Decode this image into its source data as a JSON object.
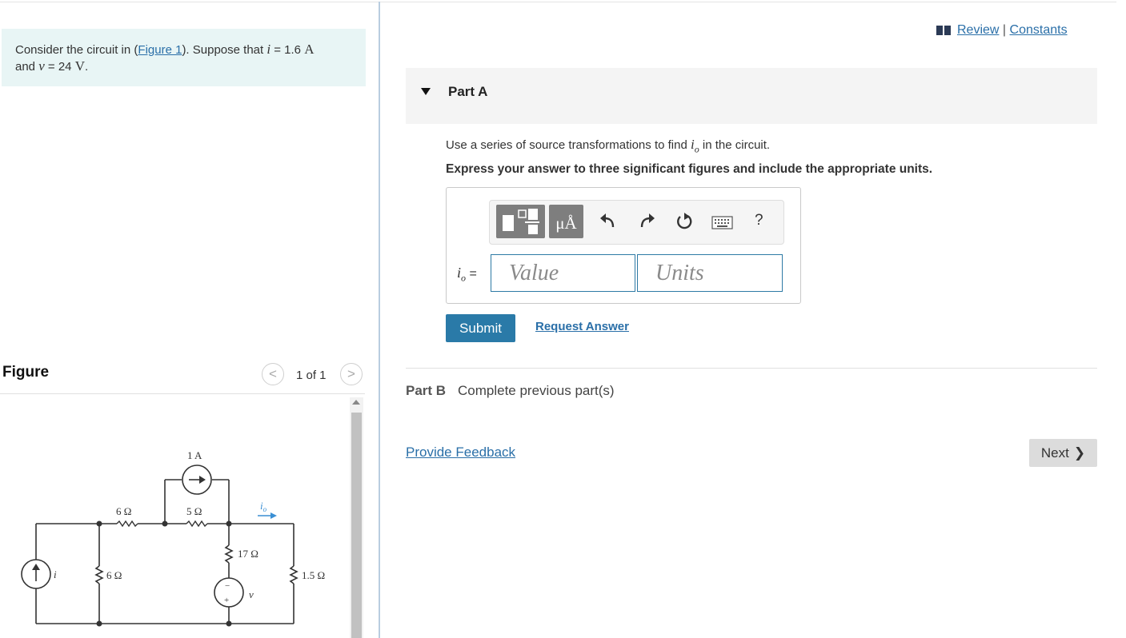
{
  "problem": {
    "prefix": "Consider the circuit in (",
    "figure_link": "Figure 1",
    "mid": "). Suppose that ",
    "i_sym": "i",
    "i_eq": " = 1.6 ",
    "i_unit": "A",
    "line2_pre": "and ",
    "v_sym": "v",
    "v_eq": " = 24 ",
    "v_unit": "V",
    "end": "."
  },
  "figure": {
    "title": "Figure",
    "pager_text": "1 of 1",
    "prev_glyph": "<",
    "next_glyph": ">",
    "labels": {
      "src_current": "1 A",
      "r_top_left": "6 Ω",
      "r_top_right": "5 Ω",
      "r_mid": "17 Ω",
      "r_left": "6 Ω",
      "r_right": "1.5 Ω",
      "i_src": "i",
      "v_src": "v",
      "io": "i",
      "io_sub": "o",
      "plus": "+",
      "minus": "−"
    }
  },
  "header": {
    "review": "Review",
    "sep": "|",
    "constants": "Constants"
  },
  "partA": {
    "title": "Part A",
    "question_pre": "Use a series of source transformations to find ",
    "question_var": "i",
    "question_sub": "o",
    "question_post": " in the circuit.",
    "instruction": "Express your answer to three significant figures and include the appropriate units.",
    "toolbar": {
      "mu_label": "μÅ",
      "help_label": "?"
    },
    "io_var": "i",
    "io_sub": "o",
    "io_eq": " =",
    "value_placeholder": "Value",
    "units_placeholder": "Units",
    "submit_label": "Submit",
    "request_label": "Request Answer"
  },
  "partB": {
    "title": "Part B",
    "status": "Complete previous part(s)"
  },
  "footer": {
    "feedback_label": "Provide Feedback",
    "next_label": "Next",
    "next_glyph": "❯"
  }
}
